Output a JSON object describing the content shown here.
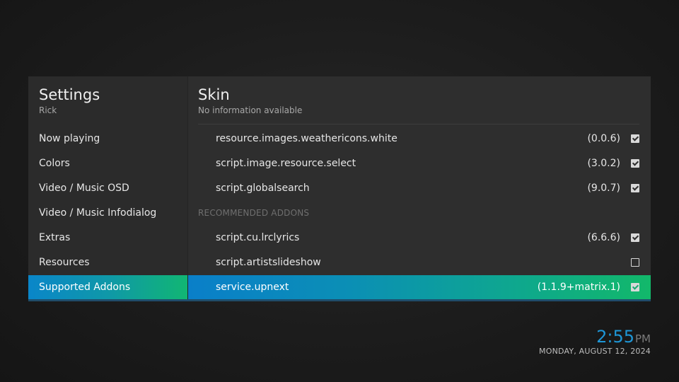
{
  "sidebar": {
    "title": "Settings",
    "subtitle": "Rick",
    "items": [
      {
        "label": "Now playing"
      },
      {
        "label": "Colors"
      },
      {
        "label": "Video / Music OSD"
      },
      {
        "label": "Video / Music Infodialog"
      },
      {
        "label": "Extras"
      },
      {
        "label": "Resources"
      },
      {
        "label": "Supported Addons",
        "selected": true
      }
    ]
  },
  "content": {
    "title": "Skin",
    "subtitle": "No information available",
    "addons": [
      {
        "name": "resource.images.weathericons.white",
        "version": "(0.0.6)",
        "checked": true
      },
      {
        "name": "script.image.resource.select",
        "version": "(3.0.2)",
        "checked": true
      },
      {
        "name": "script.globalsearch",
        "version": "(9.0.7)",
        "checked": true
      }
    ],
    "recommended_label": "RECOMMENDED ADDONS",
    "recommended": [
      {
        "name": "script.cu.lrclyrics",
        "version": "(6.6.6)",
        "checked": true
      },
      {
        "name": "script.artistslideshow",
        "version": "",
        "checked": false
      },
      {
        "name": "service.upnext",
        "version": "(1.1.9+matrix.1)",
        "checked": true,
        "focused": true
      }
    ]
  },
  "clock": {
    "time": "2:55",
    "ampm": "PM",
    "date": "MONDAY, AUGUST 12, 2024"
  },
  "colors": {
    "accent_blue": "#0a86c9",
    "accent_green": "#11b673",
    "clock_blue": "#1e96d6"
  },
  "icons": {
    "checked": "checkbox-checked-icon",
    "unchecked": "checkbox-unchecked-icon"
  }
}
